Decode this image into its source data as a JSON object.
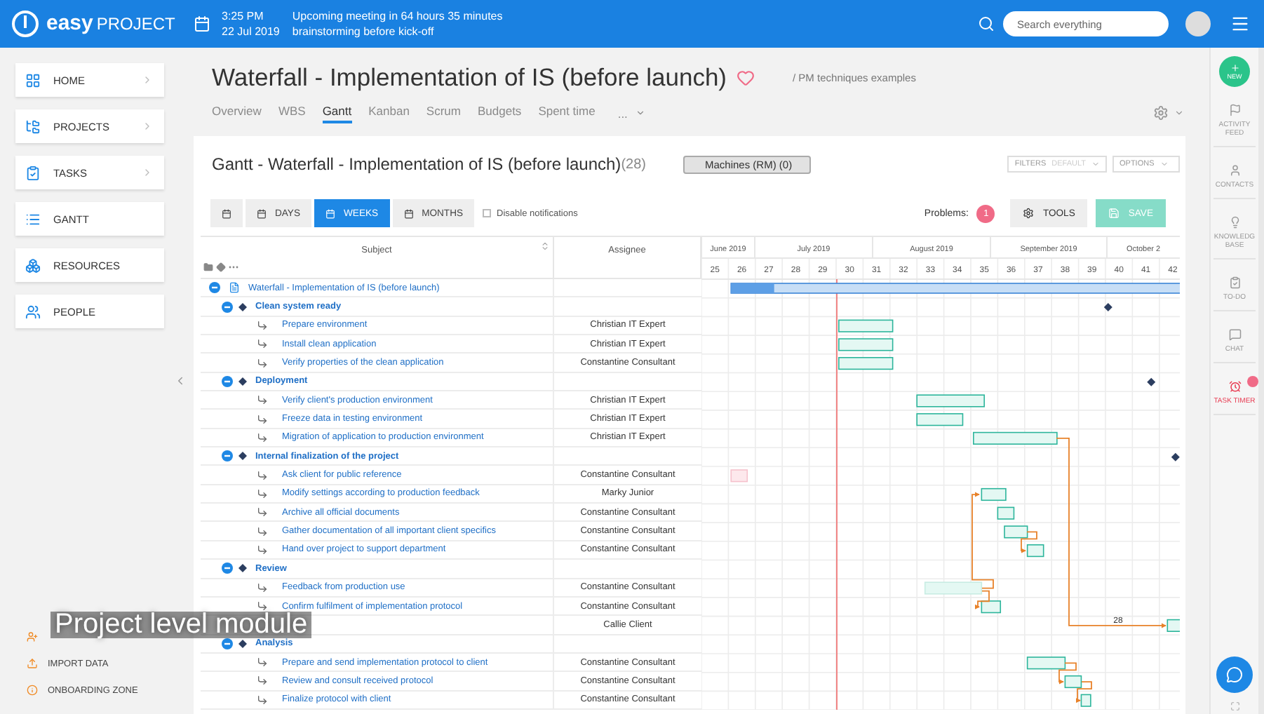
{
  "top_bar": {
    "logo": {
      "word": "easy",
      "suffix": "PROJECT"
    },
    "event": {
      "time": "3:25 PM",
      "date": "22 Jul 2019",
      "title": "Upcoming meeting in 64 hours 35 minutes",
      "subtitle": "brainstorming before kick-off"
    },
    "search": {
      "placeholder": "Search everything"
    }
  },
  "sidebar": {
    "items": [
      {
        "label": "HOME",
        "kind": "home",
        "has_submenu": true
      },
      {
        "label": "PROJECTS",
        "kind": "projects",
        "has_submenu": true
      },
      {
        "label": "TASKS",
        "kind": "tasks",
        "has_submenu": true
      },
      {
        "label": "GANTT",
        "kind": "gantt",
        "has_submenu": false
      },
      {
        "label": "RESOURCES",
        "kind": "resources",
        "has_submenu": false
      },
      {
        "label": "PEOPLE",
        "kind": "people",
        "has_submenu": false
      }
    ],
    "footer_items": [
      {
        "kind": "invite"
      },
      {
        "label": "IMPORT DATA",
        "kind": "import"
      },
      {
        "label": "ONBOARDING ZONE",
        "kind": "info"
      }
    ]
  },
  "page": {
    "title": "Waterfall - Implementation of IS (before launch)",
    "favorite": false,
    "breadcrumb": "/ PM techniques examples",
    "tabs": [
      {
        "label": "Overview",
        "selected": false
      },
      {
        "label": "WBS",
        "selected": false
      },
      {
        "label": "Gantt",
        "selected": true
      },
      {
        "label": "Kanban",
        "selected": false
      },
      {
        "label": "Scrum",
        "selected": false
      },
      {
        "label": "Budgets",
        "selected": false
      },
      {
        "label": "Spent time",
        "selected": false
      }
    ],
    "more_tab": "..."
  },
  "gantt_card": {
    "title": "Gantt - Waterfall - Implementation of IS (before launch)",
    "count": "(28)",
    "resource_button": "Machines (RM) (0)",
    "filters": {
      "label": "FILTERS",
      "value": "DEFAULT"
    },
    "options": "OPTIONS",
    "zoom_buttons": [
      {
        "label": "DAYS",
        "selected": false
      },
      {
        "label": "WEEKS",
        "selected": true
      },
      {
        "label": "MONTHS",
        "selected": false
      }
    ],
    "disable_notifications": {
      "label": "Disable notifications",
      "checked": false
    },
    "problems": {
      "label": "Problems:",
      "count": "1"
    },
    "tools": "TOOLS",
    "save": {
      "label": "SAVE",
      "disabled": true
    }
  },
  "gantt": {
    "columns": [
      "Subject",
      "Assignee"
    ],
    "months": [
      "June 2019",
      "July 2019",
      "August 2019",
      "September 2019",
      "October 2"
    ],
    "weeks": [
      "25",
      "26",
      "27",
      "28",
      "29",
      "30",
      "31",
      "32",
      "33",
      "34",
      "35",
      "36",
      "37",
      "38",
      "39",
      "40",
      "41",
      "42"
    ],
    "lag_label": "28",
    "rows": [
      {
        "kind": "project",
        "subject": "Waterfall - Implementation of IS (before launch)",
        "expanded": true,
        "children": [
          {
            "kind": "milestone",
            "subject": "Clean system ready",
            "expanded": true,
            "children": [
              {
                "kind": "task",
                "subject": "Prepare environment",
                "assignee": "Christian IT Expert"
              },
              {
                "kind": "task",
                "subject": "Install clean application",
                "assignee": "Christian IT Expert"
              },
              {
                "kind": "task",
                "subject": "Verify properties of the clean application",
                "assignee": "Constantine Consultant"
              }
            ]
          },
          {
            "kind": "milestone",
            "subject": "Deployment",
            "expanded": true,
            "children": [
              {
                "kind": "task",
                "subject": "Verify client's production environment",
                "assignee": "Christian IT Expert"
              },
              {
                "kind": "task",
                "subject": "Freeze data in testing environment",
                "assignee": "Christian IT Expert"
              },
              {
                "kind": "task",
                "subject": "Migration of application to production environment",
                "assignee": "Christian IT Expert"
              }
            ]
          },
          {
            "kind": "milestone",
            "subject": "Internal finalization of the project",
            "expanded": true,
            "children": [
              {
                "kind": "task",
                "subject": "Ask client for public reference",
                "assignee": "Constantine Consultant"
              },
              {
                "kind": "task",
                "subject": "Modify settings according to production feedback",
                "assignee": "Marky Junior"
              },
              {
                "kind": "task",
                "subject": "Archive all official documents",
                "assignee": "Constantine Consultant"
              },
              {
                "kind": "task",
                "subject": "Gather documentation of all important client specifics",
                "assignee": "Constantine Consultant"
              },
              {
                "kind": "task",
                "subject": "Hand over project to support department",
                "assignee": "Constantine Consultant"
              }
            ]
          },
          {
            "kind": "milestone",
            "subject": "Review",
            "expanded": true,
            "children": [
              {
                "kind": "task",
                "subject": "Feedback from production use",
                "assignee": "Constantine Consultant"
              },
              {
                "kind": "task",
                "subject": "Confirm fulfilment of implementation protocol",
                "assignee": "Constantine Consultant"
              },
              {
                "kind": "task",
                "assignee": "Callie Client"
              }
            ]
          },
          {
            "kind": "milestone",
            "subject": "Analysis",
            "expanded": true,
            "children": [
              {
                "kind": "task",
                "subject": "Prepare and send implementation protocol to client",
                "assignee": "Constantine Consultant"
              },
              {
                "kind": "task",
                "subject": "Review and consult received protocol",
                "assignee": "Constantine Consultant"
              },
              {
                "kind": "task",
                "subject": "Finalize protocol with client",
                "assignee": "Constantine Consultant"
              }
            ]
          }
        ]
      }
    ]
  },
  "right_rail": {
    "new_label": "NEW",
    "items": [
      {
        "label": "ACTIVITY FEED",
        "kind": "feed",
        "alert": false
      },
      {
        "label": "CONTACTS",
        "kind": "contacts",
        "alert": false
      },
      {
        "label": "KNOWLEDG BASE",
        "kind": "knowledge",
        "alert": false
      },
      {
        "label": "TO-DO",
        "kind": "todo",
        "alert": false
      },
      {
        "label": "CHAT",
        "kind": "chat",
        "alert": false
      },
      {
        "label": "TASK TIMER",
        "kind": "timer",
        "alert": true
      }
    ]
  },
  "caption": "Project level module"
}
